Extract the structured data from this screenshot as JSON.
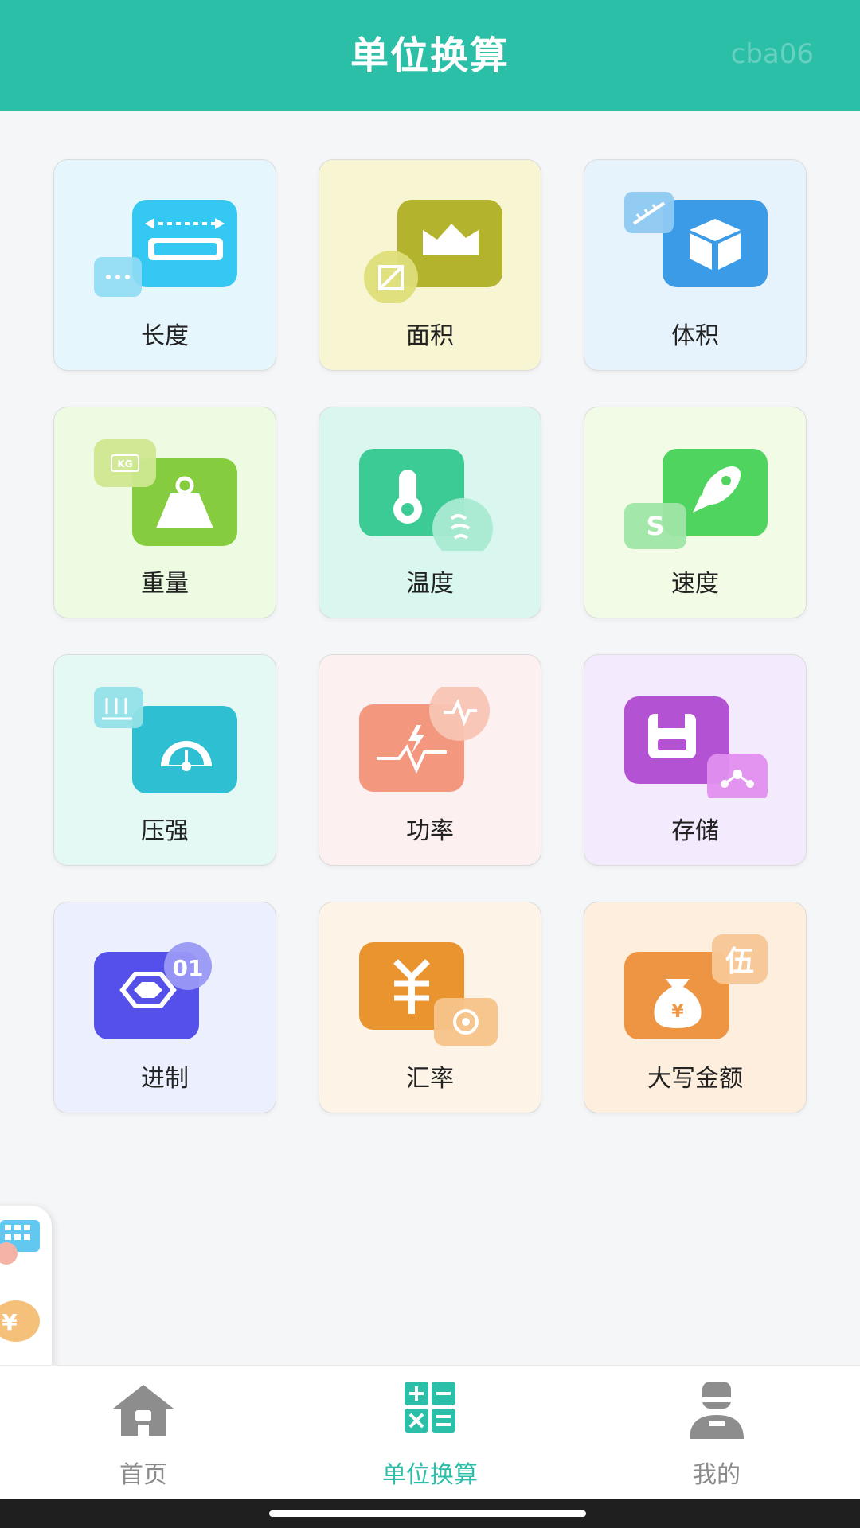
{
  "header": {
    "title": "单位换算",
    "watermark": "cba06"
  },
  "tiles": [
    {
      "label": "长度",
      "icon": "length-icon",
      "color": "#4fc3f7",
      "bg": "#e6f6fd"
    },
    {
      "label": "面积",
      "icon": "area-icon",
      "color": "#b8b83a",
      "bg": "#f8f6d2"
    },
    {
      "label": "体积",
      "icon": "volume-icon",
      "color": "#3d9de8",
      "bg": "#e7f3fc"
    },
    {
      "label": "重量",
      "icon": "weight-icon",
      "color": "#8fd04b",
      "bg": "#eefbe3"
    },
    {
      "label": "温度",
      "icon": "temperature-icon",
      "color": "#3ccf9a",
      "bg": "#d9f7ee"
    },
    {
      "label": "速度",
      "icon": "speed-icon",
      "color": "#5ed86c",
      "bg": "#f2fbe6"
    },
    {
      "label": "压强",
      "icon": "pressure-icon",
      "color": "#2cc4d4",
      "bg": "#e4f9f4"
    },
    {
      "label": "功率",
      "icon": "power-icon",
      "color": "#f59a86",
      "bg": "#fdf0f1"
    },
    {
      "label": "存储",
      "icon": "storage-icon",
      "color": "#b852d6",
      "bg": "#f3eafd"
    },
    {
      "label": "进制",
      "icon": "radix-icon",
      "color": "#5a55ee",
      "bg": "#eceffd"
    },
    {
      "label": "汇率",
      "icon": "exchange-rate-icon",
      "color": "#ee9a3a",
      "bg": "#fdf4e7"
    },
    {
      "label": "大写金额",
      "icon": "money-bag-icon",
      "color": "#f0a050",
      "bg": "#fdeede"
    }
  ],
  "badges": {
    "radix": "01",
    "money": "伍",
    "speed": "S",
    "weight": "KG"
  },
  "float_widget": [
    "calculator-icon",
    "coin-icon",
    "calculator-icon"
  ],
  "nav": [
    {
      "label": "首页",
      "icon": "home-icon",
      "active": false
    },
    {
      "label": "单位换算",
      "icon": "calculator-icon",
      "active": true
    },
    {
      "label": "我的",
      "icon": "user-icon",
      "active": false
    }
  ],
  "colors": {
    "accent": "#2cbfa8",
    "nav_inactive": "#8b8b8b"
  }
}
